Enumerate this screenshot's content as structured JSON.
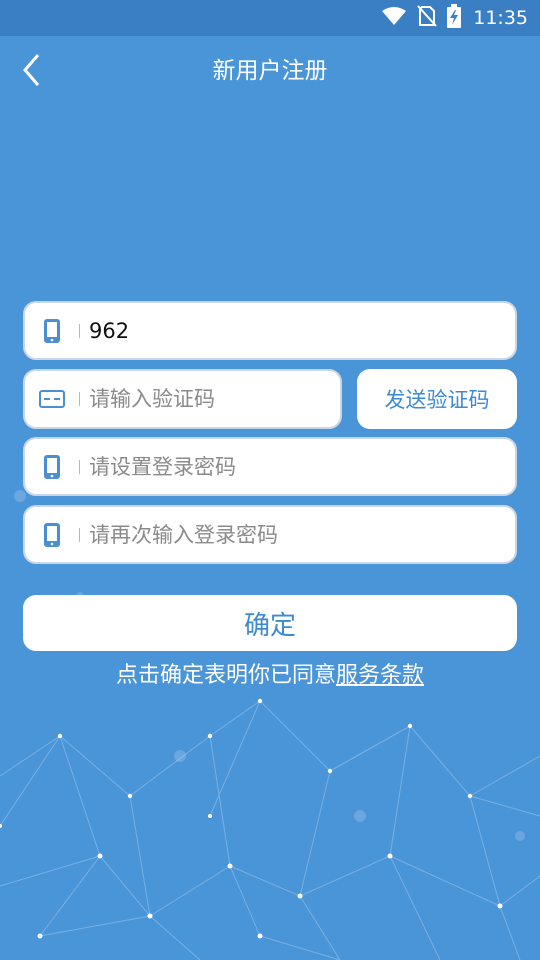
{
  "status_bar": {
    "time": "11:35",
    "icons": [
      "wifi-icon",
      "no-sim-icon",
      "battery-charging-icon"
    ]
  },
  "nav": {
    "title": "新用户注册",
    "back_icon": "chevron-left-icon"
  },
  "form": {
    "phone": {
      "value": "962",
      "icon": "phone-icon"
    },
    "verification_code": {
      "placeholder": "请输入验证码",
      "icon": "card-icon"
    },
    "send_code_label": "发送验证码",
    "password": {
      "placeholder": "请设置登录密码",
      "icon": "phone-icon"
    },
    "confirm_password": {
      "placeholder": "请再次输入登录密码",
      "icon": "phone-icon"
    },
    "confirm_label": "确定",
    "agreement_text": "点击确定表明你已同意",
    "agreement_link": "服务条款"
  },
  "colors": {
    "background": "#4a94d8",
    "status_bar": "#3a7fc4",
    "accent": "#3c8ad2",
    "field_border": "#c9d6e6"
  }
}
